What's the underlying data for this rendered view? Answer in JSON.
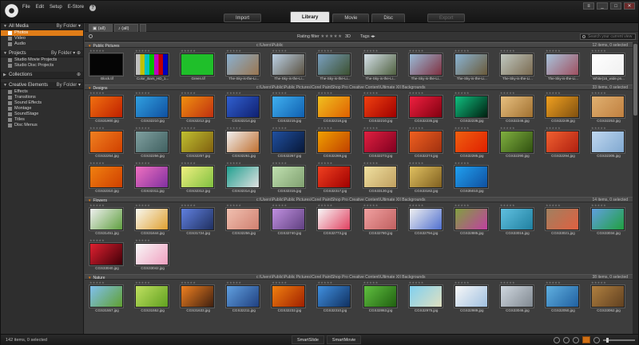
{
  "menu": [
    "File",
    "Edit",
    "Setup",
    "E-Store"
  ],
  "window_controls": [
    "≡",
    "_",
    "□",
    "✕"
  ],
  "top_tabs": {
    "import": "Import",
    "library": "Library",
    "movie": "Movie",
    "disc": "Disc",
    "export": "Export"
  },
  "sidebar": {
    "all_media": {
      "title": "All Media",
      "by": "By Folder",
      "items": [
        "Photos",
        "Video",
        "Audio"
      ]
    },
    "projects": {
      "title": "Projects",
      "by": "By Folder",
      "items": [
        "Studio Movie Projects",
        "Studio Disc Projects"
      ]
    },
    "collections": {
      "title": "Collections"
    },
    "creative": {
      "title": "Creative Elements",
      "by": "By Folder",
      "items": [
        "Effects",
        "Transitions",
        "Sound Effects",
        "Montage",
        "SoundStage",
        "Titles",
        "Disc Menus"
      ]
    }
  },
  "strip": {
    "tab1": "(all)",
    "tab2": "(all)"
  },
  "filter": {
    "rating_label": "Rating filter",
    "rating_stars": "★★★★★",
    "threed": "3D",
    "tags": "Tags",
    "search_placeholder": "Search your current view"
  },
  "groups": [
    {
      "name": "Public Pictures",
      "path": "c:\\Users\\Public",
      "count": "12 items, 0 selected",
      "items": [
        {
          "caption": "Block.tif",
          "c1": "#050505",
          "c2": "#050505"
        },
        {
          "caption": "Color_Bars_HD_1...",
          "c1": "#c8c8c8",
          "c2": "#2020c0",
          "bars": true
        },
        {
          "caption": "Green.tif",
          "c1": "#1fbf2a",
          "c2": "#1fbf2a"
        },
        {
          "caption": "The-Sky-is-the-Li...",
          "c1": "#8ab0d0",
          "c2": "#9a7650"
        },
        {
          "caption": "The-Sky-is-the-Li...",
          "c1": "#bcd2e6",
          "c2": "#5a5040"
        },
        {
          "caption": "The-Sky-is-the-Li...",
          "c1": "#7aa0c0",
          "c2": "#3c5030"
        },
        {
          "caption": "The-Sky-is-the-Li...",
          "c1": "#d6e2ea",
          "c2": "#506040"
        },
        {
          "caption": "The-Sky-is-the-Li...",
          "c1": "#9abcd8",
          "c2": "#803040"
        },
        {
          "caption": "The-Sky-is-the-Li...",
          "c1": "#8ab4d4",
          "c2": "#6a5a3a"
        },
        {
          "caption": "The-Sky-is-the-Li...",
          "c1": "#c0c8c0",
          "c2": "#7a6a50"
        },
        {
          "caption": "The-Sky-is-the-Li...",
          "c1": "#a8c4dc",
          "c2": "#a05060"
        },
        {
          "caption": "White(16_wide.pn...",
          "c1": "#ffffff",
          "c2": "#f0f0f0"
        }
      ]
    },
    {
      "name": "Designs",
      "path": "c:\\Users\\Public\\Public Pictures\\Corel PaintShop Pro Creative Content\\Ultimate XII Backgrounds",
      "count": "33 items, 0 selected",
      "items": [
        {
          "caption": "CGS31900.jpg",
          "c1": "#f07010",
          "c2": "#c02000"
        },
        {
          "caption": "CGS32210.jpg",
          "c1": "#30a0e0",
          "c2": "#1050a0"
        },
        {
          "caption": "CGS32212.jpg",
          "c1": "#f09010",
          "c2": "#c03010"
        },
        {
          "caption": "CGS32214.jpg",
          "c1": "#3060d0",
          "c2": "#102070"
        },
        {
          "caption": "CGS32215.jpg",
          "c1": "#40b0f0",
          "c2": "#1060b0"
        },
        {
          "caption": "CGS32218.jpg",
          "c1": "#f0c020",
          "c2": "#e06000"
        },
        {
          "caption": "CGS32210.jpg",
          "c1": "#f04010",
          "c2": "#a00000"
        },
        {
          "caption": "CGS32235.jpg",
          "c1": "#f02040",
          "c2": "#800010"
        },
        {
          "caption": "CGS32236.jpg",
          "c1": "#10c080",
          "c2": "#002010"
        },
        {
          "caption": "CGS32246.jpg",
          "c1": "#e8c080",
          "c2": "#a07030"
        },
        {
          "caption": "CGS32249.jpg",
          "c1": "#f0a020",
          "c2": "#805010"
        },
        {
          "caption": "CGS32253.jpg",
          "c1": "#e0b070",
          "c2": "#c08040"
        },
        {
          "caption": "CGS32254.jpg",
          "c1": "#f08020",
          "c2": "#d04000"
        },
        {
          "caption": "CGS32256.jpg",
          "c1": "#80a0a0",
          "c2": "#406060"
        },
        {
          "caption": "CGS32257.jpg",
          "c1": "#c0c030",
          "c2": "#806010"
        },
        {
          "caption": "CGS32261.jpg",
          "c1": "#f0f0f0",
          "c2": "#c07030"
        },
        {
          "caption": "CGS32267.jpg",
          "c1": "#2050a0",
          "c2": "#081838"
        },
        {
          "caption": "CGS32269.jpg",
          "c1": "#f0a000",
          "c2": "#c04000"
        },
        {
          "caption": "CGS32273.jpg",
          "c1": "#e02040",
          "c2": "#800020"
        },
        {
          "caption": "CGS32274.jpg",
          "c1": "#f06020",
          "c2": "#a03010"
        },
        {
          "caption": "CGS32285.jpg",
          "c1": "#f06010",
          "c2": "#e02000"
        },
        {
          "caption": "CGS32290.jpg",
          "c1": "#80b040",
          "c2": "#305010"
        },
        {
          "caption": "CGS32294.jpg",
          "c1": "#f06030",
          "c2": "#b02010"
        },
        {
          "caption": "CGS32305.jpg",
          "c1": "#c0d8f0",
          "c2": "#80a8d0"
        },
        {
          "caption": "CGS32310.jpg",
          "c1": "#f08010",
          "c2": "#d04000"
        },
        {
          "caption": "CGS32311.jpg",
          "c1": "#f070c0",
          "c2": "#8030a0"
        },
        {
          "caption": "CGS32312.jpg",
          "c1": "#f0f080",
          "c2": "#80c040"
        },
        {
          "caption": "CGS32314.jpg",
          "c1": "#20a090",
          "c2": "#e0e0e0"
        },
        {
          "caption": "CGS32315.jpg",
          "c1": "#c0e0b0",
          "c2": "#80a070"
        },
        {
          "caption": "CGS32317.jpg",
          "c1": "#f04020",
          "c2": "#a00000"
        },
        {
          "caption": "CGS33130.jpg",
          "c1": "#f0e0a0",
          "c2": "#c0a060"
        },
        {
          "caption": "CGS33182.jpg",
          "c1": "#e0c060",
          "c2": "#806020"
        },
        {
          "caption": "CGS35010.jpg",
          "c1": "#20a0f0",
          "c2": "#1050a0"
        }
      ]
    },
    {
      "name": "Flowers",
      "path": "c:\\Users\\Public\\Public Pictures\\Corel PaintShop Pro Creative Content\\Ultimate XII Backgrounds",
      "count": "14 items, 0 selected",
      "items": [
        {
          "caption": "CGS31451.jpg",
          "c1": "#f0f0f0",
          "c2": "#60a040"
        },
        {
          "caption": "CGS31644.jpg",
          "c1": "#f8f8f0",
          "c2": "#e0a030"
        },
        {
          "caption": "CGS31724.jpg",
          "c1": "#6080e0",
          "c2": "#203060"
        },
        {
          "caption": "CGS32256.jpg",
          "c1": "#f0c0b0",
          "c2": "#d08070"
        },
        {
          "caption": "CGS32740.jpg",
          "c1": "#c090e0",
          "c2": "#604080"
        },
        {
          "caption": "CGS32773.jpg",
          "c1": "#f8f8f8",
          "c2": "#e04060"
        },
        {
          "caption": "CGS32780.jpg",
          "c1": "#f0a0a0",
          "c2": "#c06060"
        },
        {
          "caption": "CGS32794.jpg",
          "c1": "#f0f0f0",
          "c2": "#5070d0"
        },
        {
          "caption": "CGS32885.jpg",
          "c1": "#80a040",
          "c2": "#c040a0"
        },
        {
          "caption": "CGS33016.jpg",
          "c1": "#60c0e0",
          "c2": "#2080a0"
        },
        {
          "caption": "CGS33021.jpg",
          "c1": "#a08060",
          "c2": "#e06040"
        },
        {
          "caption": "CGS33034.jpg",
          "c1": "#60a0e0",
          "c2": "#20a040"
        },
        {
          "caption": "CGS33040.jpg",
          "c1": "#e02030",
          "c2": "#400008"
        },
        {
          "caption": "CGS33042.jpg",
          "c1": "#f8f8f8",
          "c2": "#f0a0c0"
        }
      ]
    },
    {
      "name": "Nature",
      "path": "c:\\Users\\Public\\Public Pictures\\Corel PaintShop Pro Creative Content\\Ultimate XII Backgrounds",
      "count": "38 items, 0 selected",
      "items": [
        {
          "caption": "CGS31557.jpg",
          "c1": "#80c0f0",
          "c2": "#60a030"
        },
        {
          "caption": "CGS31552.jpg",
          "c1": "#c0e060",
          "c2": "#60a020"
        },
        {
          "caption": "CGS31633.jpg",
          "c1": "#f08020",
          "c2": "#402010"
        },
        {
          "caption": "CGS32211.jpg",
          "c1": "#60a0e0",
          "c2": "#204080"
        },
        {
          "caption": "CGS32232.jpg",
          "c1": "#f08010",
          "c2": "#a02000"
        },
        {
          "caption": "CGS32310.jpg",
          "c1": "#4090e0",
          "c2": "#103060"
        },
        {
          "caption": "CGS32863.jpg",
          "c1": "#60c040",
          "c2": "#206010"
        },
        {
          "caption": "CGS32975.jpg",
          "c1": "#80d0f0",
          "c2": "#e0e0c0"
        },
        {
          "caption": "CGS32989.jpg",
          "c1": "#f8f8f8",
          "c2": "#a0c0e0"
        },
        {
          "caption": "CGS33046.jpg",
          "c1": "#d0d8e0",
          "c2": "#808890"
        },
        {
          "caption": "CGS32050.jpg",
          "c1": "#60b0e0",
          "c2": "#2060a0"
        },
        {
          "caption": "CGS33062.jpg",
          "c1": "#b08040",
          "c2": "#604020"
        }
      ]
    }
  ],
  "status_text": "142 items, 0 selected",
  "bottom_buttons": [
    "SmartSlide",
    "SmartMovie"
  ]
}
